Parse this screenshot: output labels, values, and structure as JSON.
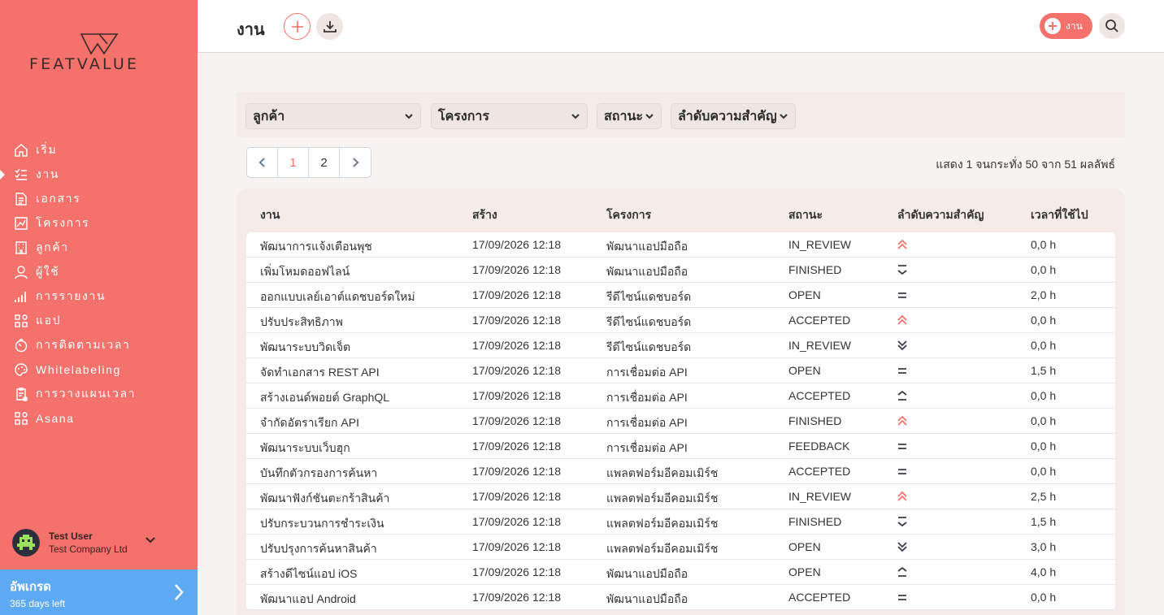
{
  "brand": {
    "name": "FEATVALUE"
  },
  "nav": [
    {
      "label": "เริ่ม",
      "icon": "home-icon"
    },
    {
      "label": "งาน",
      "icon": "tasks-icon",
      "active": true
    },
    {
      "label": "เอกสาร",
      "icon": "document-icon"
    },
    {
      "label": "โครงการ",
      "icon": "chart-icon"
    },
    {
      "label": "ลูกค้า",
      "icon": "building-icon"
    },
    {
      "label": "ผู้ใช้",
      "icon": "user-icon"
    },
    {
      "label": "การรายงาน",
      "icon": "bar-chart-icon"
    },
    {
      "label": "แอป",
      "icon": "apps-icon"
    },
    {
      "label": "การติดตามเวลา",
      "icon": "timer-icon"
    },
    {
      "label": "Whitelabeling",
      "icon": "palette-icon"
    },
    {
      "label": "การวางแผนเวลา",
      "icon": "schedule-icon"
    },
    {
      "label": "Asana",
      "icon": "apps-icon"
    }
  ],
  "user": {
    "name": "Test User",
    "company": "Test Company Ltd"
  },
  "upgrade": {
    "title": "อัพเกรด",
    "subtitle": "365 days left"
  },
  "header": {
    "title": "งาน",
    "new_button_label": "งาน"
  },
  "filters": {
    "customer": "ลูกค้า",
    "project": "โครงการ",
    "status": "สถานะ",
    "priority": "ลำดับความสำคัญ"
  },
  "pagination": {
    "pages": [
      "1",
      "2"
    ],
    "current": "1",
    "summary": "แสดง 1 จนกระทั่ง 50 จาก 51 ผลลัพธ์"
  },
  "table": {
    "columns": {
      "task": "งาน",
      "created": "สร้าง",
      "project": "โครงการ",
      "status": "สถานะ",
      "priority": "ลำดับความสำคัญ",
      "time": "เวลาที่ใช้ไป"
    },
    "rows": [
      {
        "task": "พัฒนาการแจ้งเตือนพุช",
        "created": "17/09/2026 12:18",
        "project": "พัฒนาแอปมือถือ",
        "status": "IN_REVIEW",
        "priority": "highest",
        "time": "0,0 h"
      },
      {
        "task": "เพิ่มโหมดออฟไลน์",
        "created": "17/09/2026 12:18",
        "project": "พัฒนาแอปมือถือ",
        "status": "FINISHED",
        "priority": "lowest",
        "time": "0,0 h"
      },
      {
        "task": "ออกแบบเลย์เอาต์แดชบอร์ดใหม่",
        "created": "17/09/2026 12:18",
        "project": "รีดีไซน์แดชบอร์ด",
        "status": "OPEN",
        "priority": "medium",
        "time": "2,0 h"
      },
      {
        "task": "ปรับประสิทธิภาพ",
        "created": "17/09/2026 12:18",
        "project": "รีดีไซน์แดชบอร์ด",
        "status": "ACCEPTED",
        "priority": "highest",
        "time": "0,0 h"
      },
      {
        "task": "พัฒนาระบบวิดเจ็ต",
        "created": "17/09/2026 12:18",
        "project": "รีดีไซน์แดชบอร์ด",
        "status": "IN_REVIEW",
        "priority": "low",
        "time": "0,0 h"
      },
      {
        "task": "จัดทำเอกสาร REST API",
        "created": "17/09/2026 12:18",
        "project": "การเชื่อมต่อ API",
        "status": "OPEN",
        "priority": "medium",
        "time": "1,5 h"
      },
      {
        "task": "สร้างเอนด์พอยต์ GraphQL",
        "created": "17/09/2026 12:18",
        "project": "การเชื่อมต่อ API",
        "status": "ACCEPTED",
        "priority": "high",
        "time": "0,0 h"
      },
      {
        "task": "จำกัดอัตราเรียก API",
        "created": "17/09/2026 12:18",
        "project": "การเชื่อมต่อ API",
        "status": "FINISHED",
        "priority": "highest",
        "time": "0,0 h"
      },
      {
        "task": "พัฒนาระบบเว็บฮุก",
        "created": "17/09/2026 12:18",
        "project": "การเชื่อมต่อ API",
        "status": "FEEDBACK",
        "priority": "medium",
        "time": "0,0 h"
      },
      {
        "task": "บันทึกตัวกรองการค้นหา",
        "created": "17/09/2026 12:18",
        "project": "แพลตฟอร์มอีคอมเมิร์ช",
        "status": "ACCEPTED",
        "priority": "medium",
        "time": "0,0 h"
      },
      {
        "task": "พัฒนาฟังก์ชันตะกร้าสินค้า",
        "created": "17/09/2026 12:18",
        "project": "แพลตฟอร์มอีคอมเมิร์ช",
        "status": "IN_REVIEW",
        "priority": "highest",
        "time": "2,5 h"
      },
      {
        "task": "ปรับกระบวนการชำระเงิน",
        "created": "17/09/2026 12:18",
        "project": "แพลตฟอร์มอีคอมเมิร์ช",
        "status": "FINISHED",
        "priority": "lowest",
        "time": "1,5 h"
      },
      {
        "task": "ปรับปรุงการค้นหาสินค้า",
        "created": "17/09/2026 12:18",
        "project": "แพลตฟอร์มอีคอมเมิร์ช",
        "status": "OPEN",
        "priority": "low",
        "time": "3,0 h"
      },
      {
        "task": "สร้างดีไซน์แอป iOS",
        "created": "17/09/2026 12:18",
        "project": "พัฒนาแอปมือถือ",
        "status": "OPEN",
        "priority": "high",
        "time": "4,0 h"
      },
      {
        "task": "พัฒนาแอป Android",
        "created": "17/09/2026 12:18",
        "project": "พัฒนาแอปมือถือ",
        "status": "ACCEPTED",
        "priority": "medium",
        "time": "0,0 h"
      }
    ]
  },
  "colors": {
    "accent": "#f4726b",
    "upgrade": "#5eaaf2",
    "priority_high": "#f4726b",
    "priority_neutral": "#3b3b4a"
  }
}
